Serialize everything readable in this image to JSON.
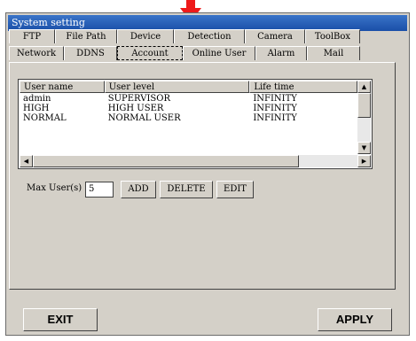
{
  "window": {
    "title": "System setting"
  },
  "tabs_row1": [
    "FTP",
    "File Path",
    "Device",
    "Detection",
    "Camera",
    "ToolBox"
  ],
  "tabs_row2": [
    "Network",
    "DDNS",
    "Account",
    "Online User",
    "Alarm",
    "Mail"
  ],
  "active_tab": "Account",
  "table": {
    "columns": [
      "User name",
      "User level",
      "Life time"
    ],
    "rows": [
      [
        "admin",
        "SUPERVISOR",
        "INFINITY"
      ],
      [
        "HIGH",
        "HIGH USER",
        "INFINITY"
      ],
      [
        "NORMAL",
        "NORMAL USER",
        "INFINITY"
      ]
    ]
  },
  "max_users": {
    "label": "Max User(s) :",
    "value": "5"
  },
  "buttons": {
    "add": "ADD",
    "delete": "DELETE",
    "edit": "EDIT",
    "exit": "EXIT",
    "apply": "APPLY"
  },
  "colors": {
    "arrow": "#ee1a1a",
    "titlebar": "#1a4fa8",
    "face": "#d4d0c8"
  }
}
